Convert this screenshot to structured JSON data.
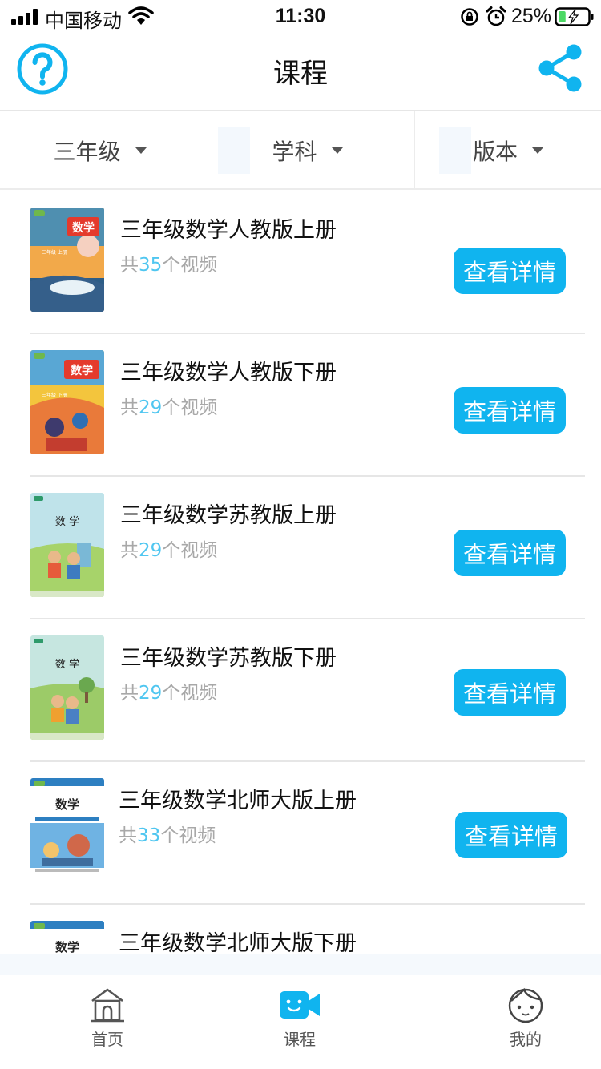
{
  "status_bar": {
    "carrier": "中国移动",
    "time": "11:30",
    "battery_percent": "25%",
    "signal_bars": 4,
    "battery_level": 0.25,
    "icons": [
      "signal-icon",
      "wifi-icon",
      "rotation-lock-icon",
      "alarm-icon",
      "battery-charging-icon"
    ]
  },
  "header": {
    "title": "课程",
    "left_icon": "help-icon",
    "right_icon": "share-icon",
    "accent": "#10b4ef"
  },
  "filters": [
    {
      "label": "三年级"
    },
    {
      "label": "学科"
    },
    {
      "label": "版本"
    }
  ],
  "courses": [
    {
      "title": "三年级数学人教版上册",
      "count_prefix": "共",
      "count": "35",
      "count_suffix": "个视频",
      "button": "查看详情",
      "cover": "math-textbook-cover"
    },
    {
      "title": "三年级数学人教版下册",
      "count_prefix": "共",
      "count": "29",
      "count_suffix": "个视频",
      "button": "查看详情",
      "cover": "math-textbook-cover"
    },
    {
      "title": "三年级数学苏教版上册",
      "count_prefix": "共",
      "count": "29",
      "count_suffix": "个视频",
      "button": "查看详情",
      "cover": "math-textbook-cover"
    },
    {
      "title": "三年级数学苏教版下册",
      "count_prefix": "共",
      "count": "29",
      "count_suffix": "个视频",
      "button": "查看详情",
      "cover": "math-textbook-cover"
    },
    {
      "title": "三年级数学北师大版上册",
      "count_prefix": "共",
      "count": "33",
      "count_suffix": "个视频",
      "button": "查看详情",
      "cover": "math-textbook-cover"
    },
    {
      "title": "三年级数学北师大版下册",
      "count_prefix": "",
      "count": "",
      "count_suffix": "",
      "button": "",
      "cover": "math-textbook-cover"
    }
  ],
  "cover_text": {
    "math": "数学",
    "math_spaced": "数 学",
    "grade_up": "三年级 上册",
    "grade_down": "三年级 下册"
  },
  "tabbar": {
    "items": [
      {
        "label": "首页",
        "icon": "home-icon"
      },
      {
        "label": "课程",
        "icon": "video-camera-icon"
      },
      {
        "label": "我的",
        "icon": "profile-face-icon"
      }
    ],
    "active_index": 1
  },
  "colors": {
    "accent": "#10b4ef",
    "count_highlight": "#4fc6f0",
    "muted_text": "#a8a8a8"
  }
}
